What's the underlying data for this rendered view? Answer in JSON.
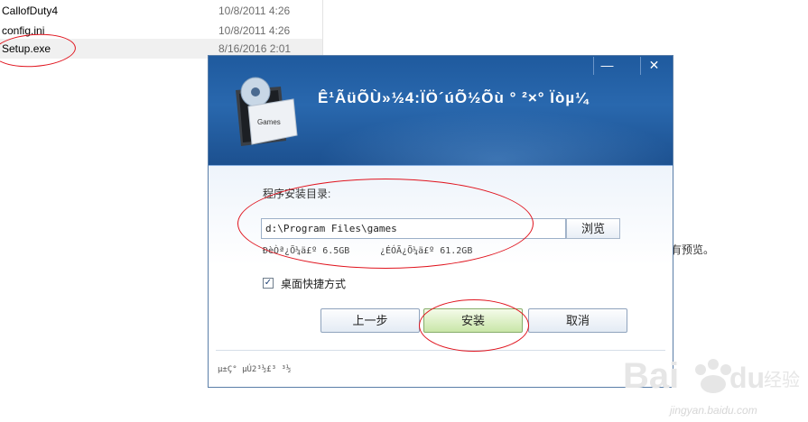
{
  "file_list": [
    {
      "name": "CallofDuty4",
      "date": "10/8/2011 4:26"
    },
    {
      "name": "config.ini",
      "date": "10/8/2011 4:26"
    },
    {
      "name": "Setup.exe",
      "date": "8/16/2016 2:01"
    }
  ],
  "preview_note": "有预览。",
  "dialog": {
    "icon_label": "Games",
    "title": "Ê¹ÃüÕÙ»½4:ÏÖ´úÕ½Õù ° ²×° Ïòµ¼",
    "minimize_glyph": "—",
    "close_glyph": "✕",
    "install_dir_label": "程序安装目录:",
    "install_path": "d:\\Program Files\\games",
    "browse_label": "浏览",
    "space_required": "ÐèÒª¿Õ¼ä£º 6.5GB",
    "space_available": "¿ÉÓÃ¿Õ¼ä£º 61.2GB",
    "desktop_shortcut_label": "桌面快捷方式",
    "desktop_shortcut_checked": true,
    "checkbox_glyph": "✓",
    "back_label": "上一步",
    "install_label": "安装",
    "cancel_label": "取消",
    "footer_text": "µ±Ç° µÚ2³½£­³ ³½"
  },
  "watermark": {
    "text": "jingyan.baidu.com"
  },
  "colors": {
    "annotation_red": "#e0141e",
    "banner_blue": "#2968ae",
    "install_green": "#c9e6a8"
  }
}
